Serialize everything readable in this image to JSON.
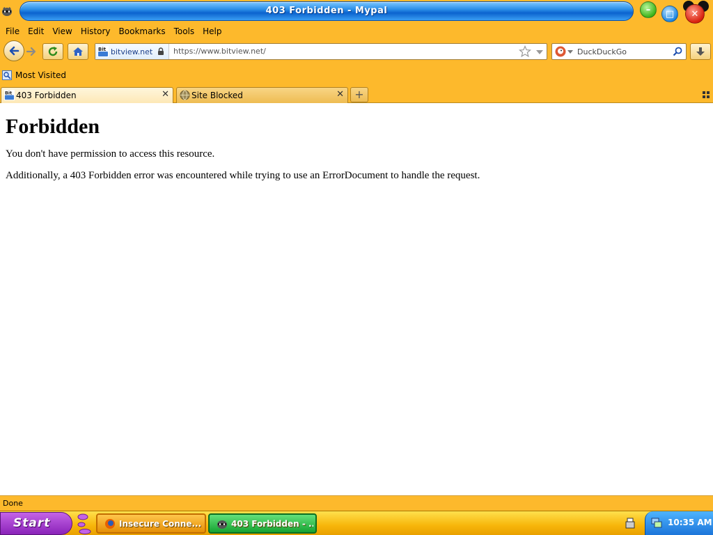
{
  "window": {
    "title": "403 Forbidden - Mypal",
    "icons": {
      "app": "raccoon-app-icon",
      "minimize": "minimize-icon",
      "maximize": "restore-icon",
      "close": "close-icon"
    }
  },
  "menu": [
    {
      "label": "File"
    },
    {
      "label": "Edit"
    },
    {
      "label": "View"
    },
    {
      "label": "History"
    },
    {
      "label": "Bookmarks"
    },
    {
      "label": "Tools"
    },
    {
      "label": "Help"
    }
  ],
  "navbar": {
    "identity_label": "bitview.net",
    "url": "https://www.bitview.net/",
    "search_placeholder": "DuckDuckGo",
    "icons": [
      "back-icon",
      "forward-icon",
      "reload-icon",
      "home-icon",
      "site-favicon",
      "lock-icon",
      "bookmark-star-icon",
      "dropdown-icon",
      "duckduckgo-icon",
      "search-icon",
      "download-icon"
    ]
  },
  "bookmarks": {
    "most_visited": "Most Visited"
  },
  "tabs": [
    {
      "label": "403 Forbidden",
      "active": true
    },
    {
      "label": "Site Blocked",
      "active": false
    }
  ],
  "content": {
    "heading": "Forbidden",
    "paragraph1": "You don't have permission to access this resource.",
    "paragraph2": "Additionally, a 403 Forbidden error was encountered while trying to use an ErrorDocument to handle the request."
  },
  "status": {
    "text": "Done"
  },
  "taskbar": {
    "start_label": "Start",
    "tasks": [
      {
        "label": "Insecure Conne..."
      },
      {
        "label": "403 Forbidden - ..."
      }
    ],
    "clock": "10:35 AM"
  },
  "colors": {
    "chrome": "#fdb92c",
    "title_blue": "#0b63cf",
    "start_purple": "#8a23b9"
  }
}
